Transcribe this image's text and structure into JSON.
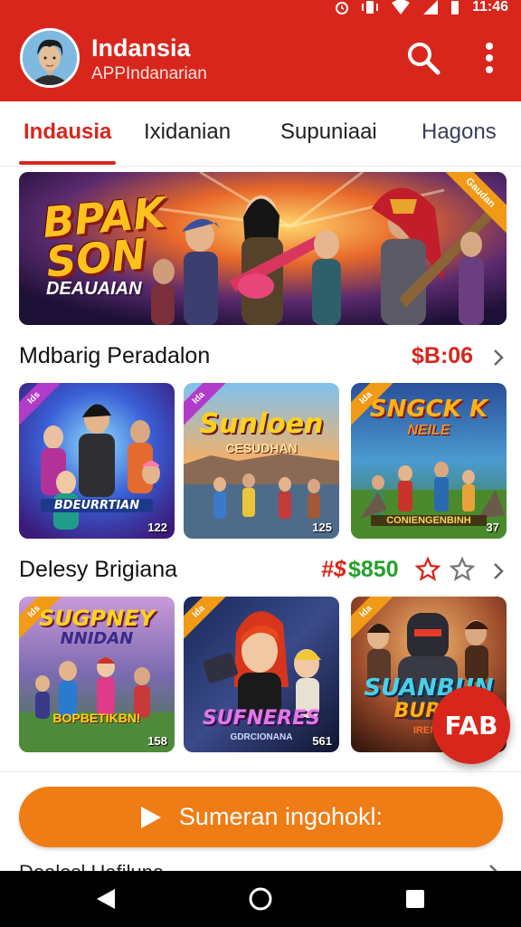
{
  "status_bar": {
    "time": "11:46"
  },
  "app_bar": {
    "title": "Indansia",
    "subtitle": "APPIndanarian",
    "search_icon": "search-icon",
    "menu_icon": "more-vert-icon",
    "color": "#d8261c"
  },
  "tabs": [
    {
      "label": "Indausia",
      "active": true
    },
    {
      "label": "Ixidanian",
      "active": false
    },
    {
      "label": "Supuniaai",
      "active": false
    },
    {
      "label": "Hagons",
      "active": false
    }
  ],
  "banner": {
    "title_line1": "BPAK",
    "title_line2": "SON",
    "subtitle": "DEAUAIAN",
    "ribbon": "Gaudan"
  },
  "section1": {
    "title": "Mdbarig Peradalon",
    "value": "$B:06",
    "cards": [
      {
        "badge": "Ids",
        "title": "BDEURRTIAN",
        "count": "122"
      },
      {
        "badge": "Ida",
        "title": "Sunloen",
        "subtitle": "CESUDHAN",
        "count": "125"
      },
      {
        "badge": "Ida",
        "title": "SNGCK K",
        "subtitle_top": "NEILE",
        "subtitle": "CONIENGENBINH",
        "count": "37"
      }
    ]
  },
  "section2": {
    "title": "Delesy Brigiana",
    "value_prefix": "#$",
    "value": "$850",
    "stars": [
      "filled-outline-red",
      "outline-gray"
    ],
    "cards": [
      {
        "badge": "Ids",
        "title": "SUGPNEY",
        "title2": "NNIDAN",
        "subtitle": "BOPBETIKBN!",
        "count": "158"
      },
      {
        "badge": "Ida",
        "title": "SUFNERES",
        "subtitle": "GDRCIONANA",
        "count": "561"
      },
      {
        "badge": "Ida",
        "title": "SUANBUN",
        "title2": "BURAI",
        "subtitle": "IRENC",
        "count": ""
      }
    ]
  },
  "fab": {
    "label": "FAB"
  },
  "cta": {
    "label": "Sumeran ingohokl:",
    "icon": "play-icon",
    "color": "#ef7c14"
  },
  "peek": {
    "text": "Dealesl Hafiluna"
  },
  "nav": {
    "back": "back-icon",
    "home": "home-icon",
    "recents": "recents-icon"
  }
}
